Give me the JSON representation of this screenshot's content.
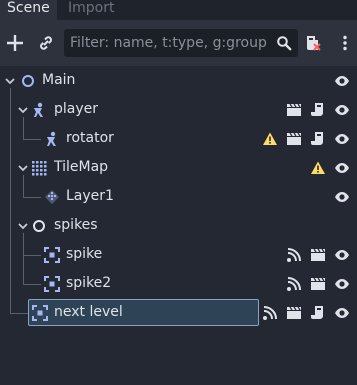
{
  "tabs": [
    {
      "label": "Scene",
      "active": true
    },
    {
      "label": "Import",
      "active": false
    }
  ],
  "toolbar": {
    "add_icon": "plus-icon",
    "link_icon": "link-icon",
    "filter_placeholder": "Filter: name, t:type, g:group",
    "filter_value": "",
    "search_icon": "search-icon",
    "script_icon": "script-remove-icon",
    "more_icon": "vertical-dots-icon"
  },
  "tree": {
    "nodes": [
      {
        "name": "Main",
        "type": "Node2D",
        "depth": 0,
        "expanded": true,
        "icons": [
          "eye-icon"
        ]
      },
      {
        "name": "player",
        "type": "CharacterBody2D",
        "depth": 1,
        "expanded": true,
        "icons": [
          "clapperboard-icon",
          "script-icon",
          "eye-icon"
        ]
      },
      {
        "name": "rotator",
        "type": "CharacterBody2D",
        "depth": 2,
        "icons": [
          "warning-icon",
          "clapperboard-icon",
          "script-icon",
          "eye-icon"
        ]
      },
      {
        "name": "TileMap",
        "type": "TileMap",
        "depth": 1,
        "expanded": true,
        "icons": [
          "warning-icon",
          "eye-icon"
        ]
      },
      {
        "name": "Layer1",
        "type": "TileMapLayer",
        "depth": 2,
        "icons": [
          "eye-icon"
        ]
      },
      {
        "name": "spikes",
        "type": "Node2D",
        "depth": 1,
        "expanded": true,
        "icons": []
      },
      {
        "name": "spike",
        "type": "Area2D",
        "depth": 2,
        "icons": [
          "signal-icon",
          "clapperboard-icon",
          "eye-icon"
        ]
      },
      {
        "name": "spike2",
        "type": "Area2D",
        "depth": 2,
        "icons": [
          "signal-icon",
          "clapperboard-icon",
          "eye-icon"
        ]
      },
      {
        "name": "next level",
        "type": "Area2D",
        "depth": 1,
        "selected": true,
        "icons": [
          "signal-icon",
          "clapperboard-icon",
          "script-icon",
          "eye-icon"
        ]
      }
    ]
  },
  "colors": {
    "background": "#232832",
    "toolbar": "#2d323c",
    "node2d_blue": "#a5b7f3",
    "warning": "#ffdd65",
    "selection": "#2e4356"
  }
}
